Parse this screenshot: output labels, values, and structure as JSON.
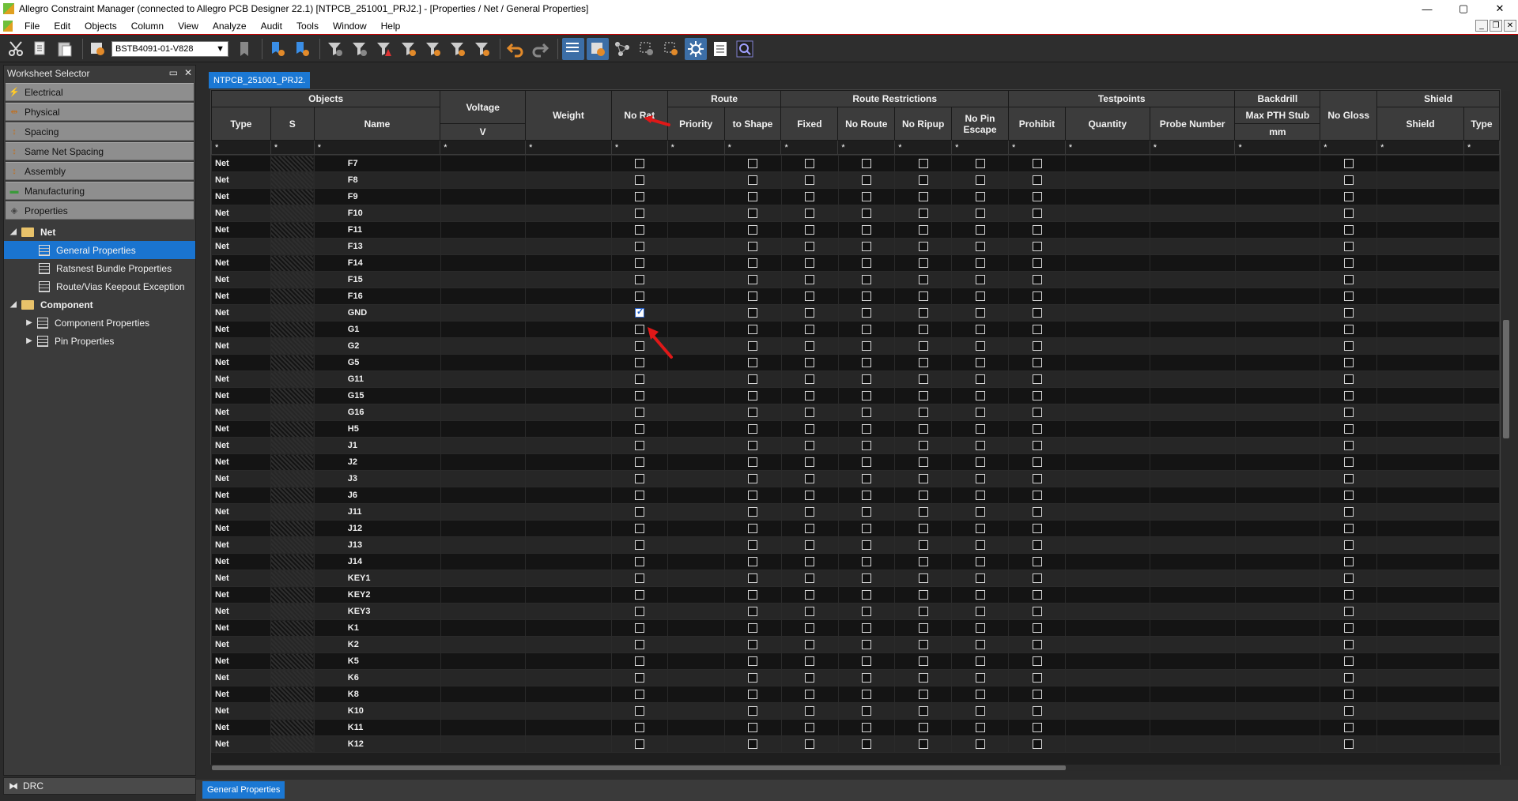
{
  "window": {
    "title": "Allegro Constraint Manager (connected to Allegro PCB Designer 22.1) [NTPCB_251001_PRJ2.] - [Properties / Net / General Properties]",
    "min": "—",
    "max": "▢",
    "close": "✕"
  },
  "menu": [
    "File",
    "Edit",
    "Objects",
    "Column",
    "View",
    "Analyze",
    "Audit",
    "Tools",
    "Window",
    "Help"
  ],
  "toolbar": {
    "design_select": "BSTB4091-01-V828"
  },
  "worksheet_selector": {
    "title": "Worksheet Selector",
    "sections": [
      "Electrical",
      "Physical",
      "Spacing",
      "Same Net Spacing",
      "Assembly",
      "Manufacturing",
      "Properties"
    ],
    "tree": [
      {
        "label": "Net",
        "level": 0,
        "kind": "folder"
      },
      {
        "label": "General Properties",
        "level": 1,
        "kind": "sheet"
      },
      {
        "label": "Ratsnest Bundle Properties",
        "level": 1,
        "kind": "sheet"
      },
      {
        "label": "Route/Vias Keepout Exception",
        "level": 1,
        "kind": "sheet"
      },
      {
        "label": "Component",
        "level": 0,
        "kind": "folder"
      },
      {
        "label": "Component Properties",
        "level": 1,
        "kind": "sheet"
      },
      {
        "label": "Pin Properties",
        "level": 1,
        "kind": "sheet"
      }
    ],
    "drc": "DRC"
  },
  "doc_tab": "NTPCB_251001_PRJ2.",
  "bottom_tab": "General Properties",
  "grid": {
    "groups": {
      "objects": "Objects",
      "voltage": "Voltage",
      "weight": "Weight",
      "no_rat": "No Rat",
      "route": "Route",
      "route_restrictions": "Route Restrictions",
      "testpoints": "Testpoints",
      "backdrill": "Backdrill",
      "no_gloss": "No Gloss",
      "shield": "Shield"
    },
    "cols": {
      "type": "Type",
      "s": "S",
      "name": "Name",
      "voltage_unit": "V",
      "priority": "Priority",
      "to_shape": "to Shape",
      "fixed": "Fixed",
      "no_route": "No Route",
      "no_ripup": "No Ripup",
      "no_pin_escape": "No Pin Escape",
      "prohibit": "Prohibit",
      "quantity": "Quantity",
      "probe_number": "Probe Number",
      "max_pth_stub": "Max PTH Stub",
      "backdrill_unit": "mm",
      "shield": "Shield",
      "shield_type": "Type"
    },
    "filter": "*",
    "rows": [
      {
        "type": "Net",
        "name": "F7",
        "no_rat": false
      },
      {
        "type": "Net",
        "name": "F8",
        "no_rat": false
      },
      {
        "type": "Net",
        "name": "F9",
        "no_rat": false
      },
      {
        "type": "Net",
        "name": "F10",
        "no_rat": false
      },
      {
        "type": "Net",
        "name": "F11",
        "no_rat": false
      },
      {
        "type": "Net",
        "name": "F13",
        "no_rat": false
      },
      {
        "type": "Net",
        "name": "F14",
        "no_rat": false
      },
      {
        "type": "Net",
        "name": "F15",
        "no_rat": false
      },
      {
        "type": "Net",
        "name": "F16",
        "no_rat": false
      },
      {
        "type": "Net",
        "name": "GND",
        "no_rat": true
      },
      {
        "type": "Net",
        "name": "G1",
        "no_rat": false
      },
      {
        "type": "Net",
        "name": "G2",
        "no_rat": false
      },
      {
        "type": "Net",
        "name": "G5",
        "no_rat": false
      },
      {
        "type": "Net",
        "name": "G11",
        "no_rat": false
      },
      {
        "type": "Net",
        "name": "G15",
        "no_rat": false
      },
      {
        "type": "Net",
        "name": "G16",
        "no_rat": false
      },
      {
        "type": "Net",
        "name": "H5",
        "no_rat": false
      },
      {
        "type": "Net",
        "name": "J1",
        "no_rat": false
      },
      {
        "type": "Net",
        "name": "J2",
        "no_rat": false
      },
      {
        "type": "Net",
        "name": "J3",
        "no_rat": false
      },
      {
        "type": "Net",
        "name": "J6",
        "no_rat": false
      },
      {
        "type": "Net",
        "name": "J11",
        "no_rat": false
      },
      {
        "type": "Net",
        "name": "J12",
        "no_rat": false
      },
      {
        "type": "Net",
        "name": "J13",
        "no_rat": false
      },
      {
        "type": "Net",
        "name": "J14",
        "no_rat": false
      },
      {
        "type": "Net",
        "name": "KEY1",
        "no_rat": false
      },
      {
        "type": "Net",
        "name": "KEY2",
        "no_rat": false
      },
      {
        "type": "Net",
        "name": "KEY3",
        "no_rat": false
      },
      {
        "type": "Net",
        "name": "K1",
        "no_rat": false
      },
      {
        "type": "Net",
        "name": "K2",
        "no_rat": false
      },
      {
        "type": "Net",
        "name": "K5",
        "no_rat": false
      },
      {
        "type": "Net",
        "name": "K6",
        "no_rat": false
      },
      {
        "type": "Net",
        "name": "K8",
        "no_rat": false
      },
      {
        "type": "Net",
        "name": "K10",
        "no_rat": false
      },
      {
        "type": "Net",
        "name": "K11",
        "no_rat": false
      },
      {
        "type": "Net",
        "name": "K12",
        "no_rat": false
      }
    ]
  }
}
